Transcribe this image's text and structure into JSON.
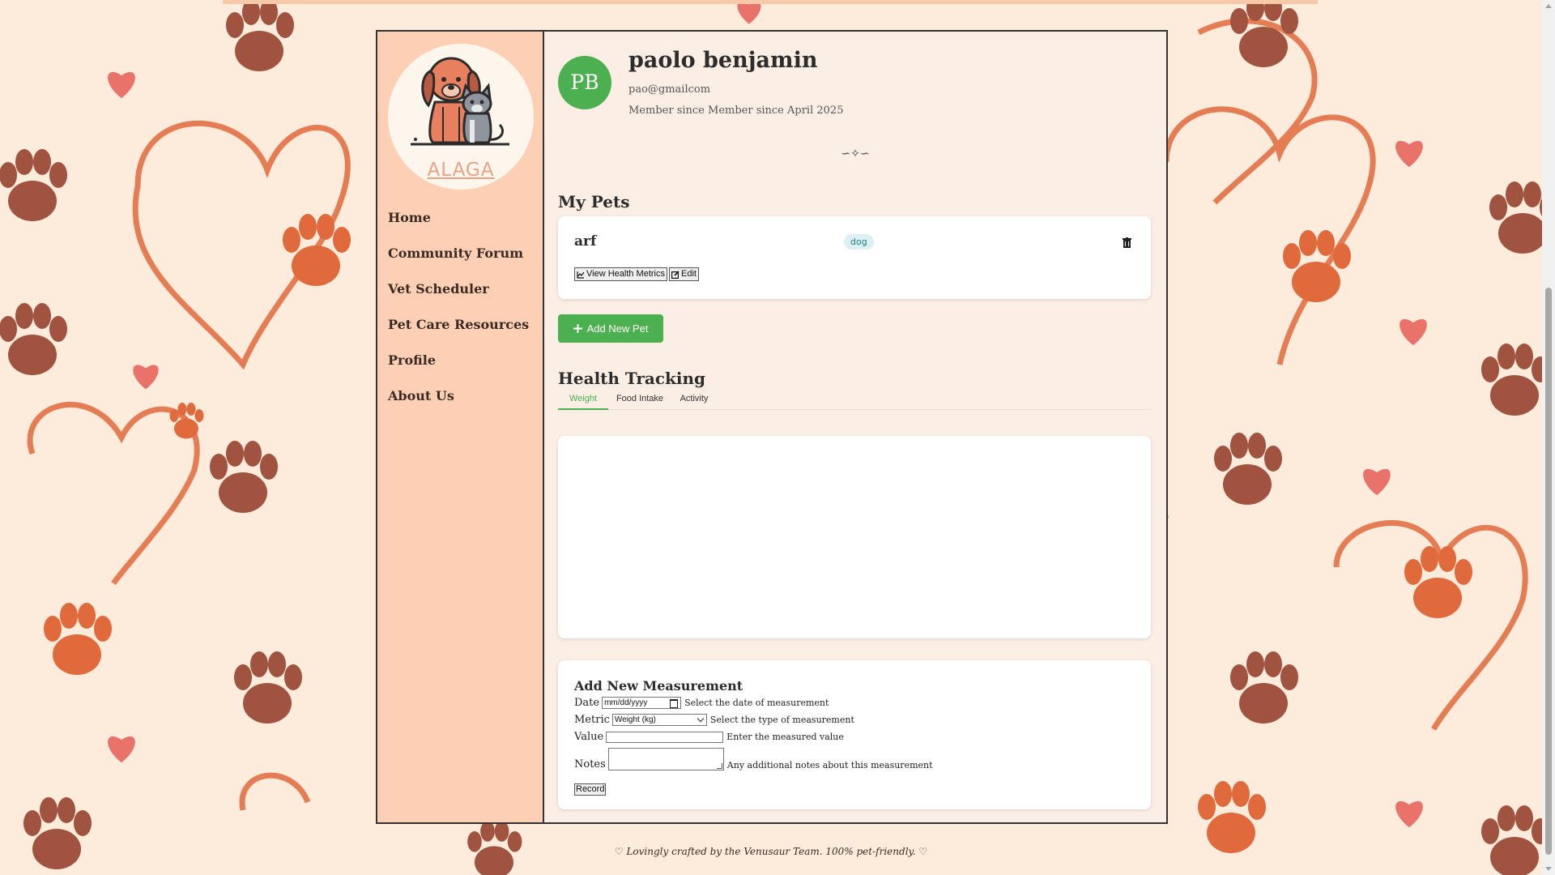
{
  "app": {
    "logo_text": "ALAGA",
    "nav": [
      "Home",
      "Community Forum",
      "Vet Scheduler",
      "Pet Care Resources",
      "Profile",
      "About Us"
    ]
  },
  "profile": {
    "initials": "PB",
    "name": "paolo benjamin",
    "email": "pao@gmailcom",
    "member_since": "Member since Member since April 2025",
    "divider": "∽✧∽"
  },
  "pets": {
    "title": "My Pets",
    "items": [
      {
        "name": "arf",
        "species": "dog",
        "view_label": "View Health Metrics",
        "edit_label": "Edit"
      }
    ],
    "add_label": "Add New Pet"
  },
  "health": {
    "title": "Health Tracking",
    "tabs": [
      "Weight",
      "Food Intake",
      "Activity"
    ],
    "active_tab": "Weight"
  },
  "measurement_form": {
    "title": "Add New Measurement",
    "date_label": "Date",
    "date_placeholder": "mm/dd/yyyy",
    "date_hint": "Select the date of measurement",
    "metric_label": "Metric",
    "metric_value": "Weight (kg)",
    "metric_hint": "Select the type of measurement",
    "value_label": "Value",
    "value_hint": "Enter the measured value",
    "notes_label": "Notes",
    "notes_hint": "Any additional notes about this measurement",
    "submit_label": "Record"
  },
  "footer": "♡ Lovingly crafted by the Venusaur Team. 100% pet-friendly. ♡",
  "colors": {
    "accent": "#4caf50",
    "sidebar": "#fdd0b5",
    "background": "#fdebdc",
    "paw": "#e06a3c",
    "paw_dark": "#a0533f"
  }
}
